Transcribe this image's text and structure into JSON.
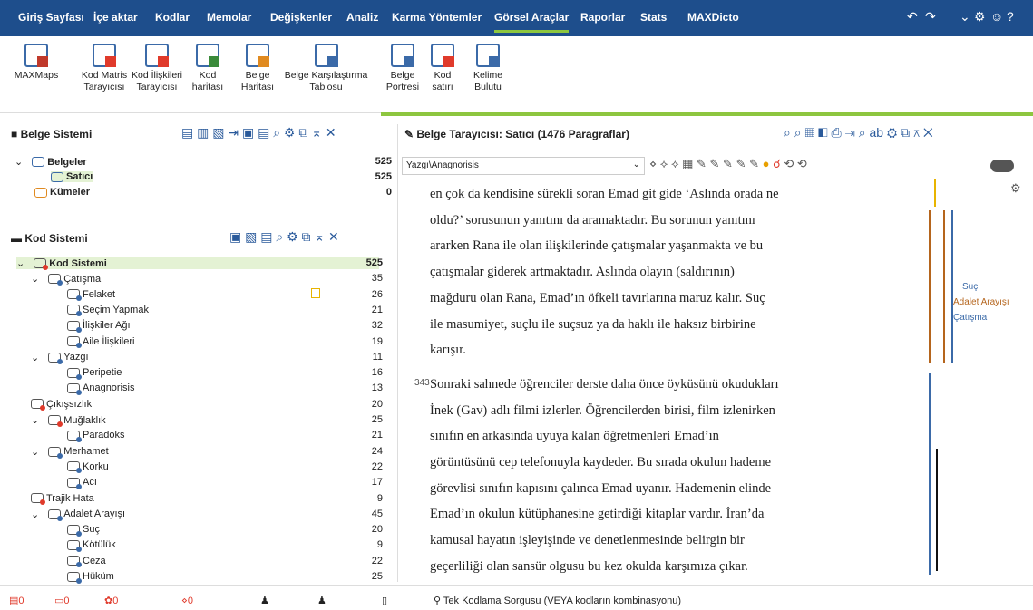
{
  "menu": {
    "tabs": [
      "Giriş Sayfası",
      "İçe aktar",
      "Kodlar",
      "Memolar",
      "Değişkenler",
      "Analiz",
      "Karma Yöntemler",
      "Görsel Araçlar",
      "Raporlar",
      "Stats",
      "MAXDicto"
    ]
  },
  "ribbon": {
    "buttons": [
      {
        "l1": "MAXMaps",
        "l2": "",
        "color": "#c0392b"
      },
      {
        "l1": "Kod Matris",
        "l2": "Tarayıcısı",
        "color": "#e03a2b"
      },
      {
        "l1": "Kod İlişkileri",
        "l2": "Tarayıcısı",
        "color": "#e03a2b"
      },
      {
        "l1": "Kod",
        "l2": "haritası",
        "color": "#3a8a3a"
      },
      {
        "l1": "Belge",
        "l2": "Haritası",
        "color": "#e08a20"
      },
      {
        "l1": "Belge Karşılaştırma",
        "l2": "Tablosu",
        "color": "#3b6aa8"
      },
      {
        "l1": "Belge",
        "l2": "Portresi",
        "color": "#3b6aa8"
      },
      {
        "l1": "Kod",
        "l2": "satırı",
        "color": "#e03a2b"
      },
      {
        "l1": "Kelime",
        "l2": "Bulutu",
        "color": "#3b6aa8"
      }
    ]
  },
  "belge": {
    "title": "Belge Sistemi",
    "rows": [
      {
        "label": "Belgeler",
        "count": "525"
      },
      {
        "label": "Satıcı",
        "count": "525"
      },
      {
        "label": "Kümeler",
        "count": "0"
      }
    ]
  },
  "kod": {
    "title": "Kod Sistemi",
    "rows": [
      {
        "label": "Kod Sistemi",
        "count": "525",
        "lvl": 0
      },
      {
        "label": "Çatışma",
        "count": "35",
        "lvl": 1
      },
      {
        "label": "Felaket",
        "count": "26",
        "lvl": 2
      },
      {
        "label": "Seçim Yapmak",
        "count": "21",
        "lvl": 2
      },
      {
        "label": "İlişkiler Ağı",
        "count": "32",
        "lvl": 2
      },
      {
        "label": "Aile İlişkileri",
        "count": "19",
        "lvl": 2
      },
      {
        "label": "Yazgı",
        "count": "11",
        "lvl": 1
      },
      {
        "label": "Peripetie",
        "count": "16",
        "lvl": 2
      },
      {
        "label": "Anagnorisis",
        "count": "13",
        "lvl": 2
      },
      {
        "label": "Çıkışsızlık",
        "count": "20",
        "lvl": 1
      },
      {
        "label": "Muğlaklık",
        "count": "25",
        "lvl": 1
      },
      {
        "label": "Paradoks",
        "count": "21",
        "lvl": 2
      },
      {
        "label": "Merhamet",
        "count": "24",
        "lvl": 1
      },
      {
        "label": "Korku",
        "count": "22",
        "lvl": 2
      },
      {
        "label": "Acı",
        "count": "17",
        "lvl": 2
      },
      {
        "label": "Trajik Hata",
        "count": "9",
        "lvl": 1
      },
      {
        "label": "Adalet Arayışı",
        "count": "45",
        "lvl": 1
      },
      {
        "label": "Suç",
        "count": "20",
        "lvl": 2
      },
      {
        "label": "Kötülük",
        "count": "9",
        "lvl": 2
      },
      {
        "label": "Ceza",
        "count": "22",
        "lvl": 2
      },
      {
        "label": "Hüküm",
        "count": "25",
        "lvl": 2
      }
    ]
  },
  "browser": {
    "title": "Belge Tarayıcısı: Satıcı  (1476 Paragraflar)",
    "code_select": "Yazgı\\Anagnorisis",
    "para_num": "343",
    "lines": [
      "en çok da kendisine sürekli soran Emad git gide ‘Aslında orada ne",
      "oldu?’ sorusunun yanıtını da aramaktadır. Bu sorunun yanıtını",
      "ararken Rana ile olan ilişkilerinde çatışmalar yaşanmakta ve bu",
      "çatışmalar giderek artmaktadır. Aslında olayın (saldırının)",
      "mağduru olan Rana, Emad’ın öfkeli tavırlarına maruz kalır. Suç",
      "ile masumiyet, suçlu ile suçsuz ya da haklı ile haksız birbirine",
      "karışır.",
      "Sonraki sahnede öğrenciler derste daha önce öyküsünü okudukları",
      "İnek (Gav) adlı filmi izlerler. Öğrencilerden birisi, film izlenirken",
      "sınıfın en arkasında uyuya kalan öğretmenleri Emad’ın",
      "görüntüsünü cep telefonuyla kaydeder. Bu sırada okulun hademe",
      "görevlisi sınıfın kapısını çalınca Emad uyanır. Hademenin elinde",
      "Emad’ın okulun kütüphanesine getirdiği kitaplar vardır. İran’da",
      "kamusal hayatın işleyişinde ve denetlenmesinde belirgin bir",
      "geçerliliği olan sansür olgusu bu kez okulda karşımıza çıkar."
    ],
    "code_labels": [
      "Suç",
      "Adalet Arayışı",
      "Çatışma"
    ]
  },
  "status": {
    "counts": [
      "0",
      "0",
      "0",
      "0"
    ],
    "query": "Tek Kodlama Sorgusu (VEYA kodların kombinasyonu)"
  }
}
